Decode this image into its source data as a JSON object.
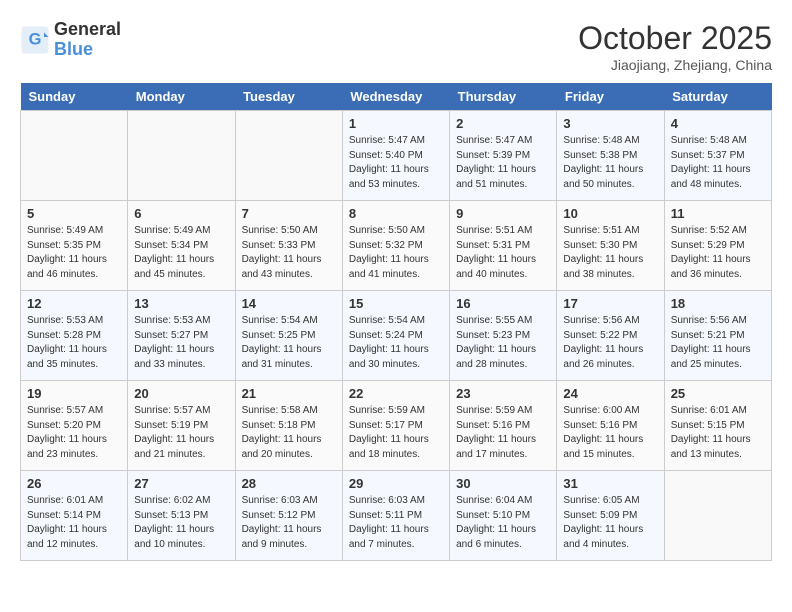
{
  "header": {
    "logo_line1": "General",
    "logo_line2": "Blue",
    "month": "October 2025",
    "location": "Jiaojiang, Zhejiang, China"
  },
  "weekdays": [
    "Sunday",
    "Monday",
    "Tuesday",
    "Wednesday",
    "Thursday",
    "Friday",
    "Saturday"
  ],
  "weeks": [
    [
      {
        "day": "",
        "info": ""
      },
      {
        "day": "",
        "info": ""
      },
      {
        "day": "",
        "info": ""
      },
      {
        "day": "1",
        "info": "Sunrise: 5:47 AM\nSunset: 5:40 PM\nDaylight: 11 hours\nand 53 minutes."
      },
      {
        "day": "2",
        "info": "Sunrise: 5:47 AM\nSunset: 5:39 PM\nDaylight: 11 hours\nand 51 minutes."
      },
      {
        "day": "3",
        "info": "Sunrise: 5:48 AM\nSunset: 5:38 PM\nDaylight: 11 hours\nand 50 minutes."
      },
      {
        "day": "4",
        "info": "Sunrise: 5:48 AM\nSunset: 5:37 PM\nDaylight: 11 hours\nand 48 minutes."
      }
    ],
    [
      {
        "day": "5",
        "info": "Sunrise: 5:49 AM\nSunset: 5:35 PM\nDaylight: 11 hours\nand 46 minutes."
      },
      {
        "day": "6",
        "info": "Sunrise: 5:49 AM\nSunset: 5:34 PM\nDaylight: 11 hours\nand 45 minutes."
      },
      {
        "day": "7",
        "info": "Sunrise: 5:50 AM\nSunset: 5:33 PM\nDaylight: 11 hours\nand 43 minutes."
      },
      {
        "day": "8",
        "info": "Sunrise: 5:50 AM\nSunset: 5:32 PM\nDaylight: 11 hours\nand 41 minutes."
      },
      {
        "day": "9",
        "info": "Sunrise: 5:51 AM\nSunset: 5:31 PM\nDaylight: 11 hours\nand 40 minutes."
      },
      {
        "day": "10",
        "info": "Sunrise: 5:51 AM\nSunset: 5:30 PM\nDaylight: 11 hours\nand 38 minutes."
      },
      {
        "day": "11",
        "info": "Sunrise: 5:52 AM\nSunset: 5:29 PM\nDaylight: 11 hours\nand 36 minutes."
      }
    ],
    [
      {
        "day": "12",
        "info": "Sunrise: 5:53 AM\nSunset: 5:28 PM\nDaylight: 11 hours\nand 35 minutes."
      },
      {
        "day": "13",
        "info": "Sunrise: 5:53 AM\nSunset: 5:27 PM\nDaylight: 11 hours\nand 33 minutes."
      },
      {
        "day": "14",
        "info": "Sunrise: 5:54 AM\nSunset: 5:25 PM\nDaylight: 11 hours\nand 31 minutes."
      },
      {
        "day": "15",
        "info": "Sunrise: 5:54 AM\nSunset: 5:24 PM\nDaylight: 11 hours\nand 30 minutes."
      },
      {
        "day": "16",
        "info": "Sunrise: 5:55 AM\nSunset: 5:23 PM\nDaylight: 11 hours\nand 28 minutes."
      },
      {
        "day": "17",
        "info": "Sunrise: 5:56 AM\nSunset: 5:22 PM\nDaylight: 11 hours\nand 26 minutes."
      },
      {
        "day": "18",
        "info": "Sunrise: 5:56 AM\nSunset: 5:21 PM\nDaylight: 11 hours\nand 25 minutes."
      }
    ],
    [
      {
        "day": "19",
        "info": "Sunrise: 5:57 AM\nSunset: 5:20 PM\nDaylight: 11 hours\nand 23 minutes."
      },
      {
        "day": "20",
        "info": "Sunrise: 5:57 AM\nSunset: 5:19 PM\nDaylight: 11 hours\nand 21 minutes."
      },
      {
        "day": "21",
        "info": "Sunrise: 5:58 AM\nSunset: 5:18 PM\nDaylight: 11 hours\nand 20 minutes."
      },
      {
        "day": "22",
        "info": "Sunrise: 5:59 AM\nSunset: 5:17 PM\nDaylight: 11 hours\nand 18 minutes."
      },
      {
        "day": "23",
        "info": "Sunrise: 5:59 AM\nSunset: 5:16 PM\nDaylight: 11 hours\nand 17 minutes."
      },
      {
        "day": "24",
        "info": "Sunrise: 6:00 AM\nSunset: 5:16 PM\nDaylight: 11 hours\nand 15 minutes."
      },
      {
        "day": "25",
        "info": "Sunrise: 6:01 AM\nSunset: 5:15 PM\nDaylight: 11 hours\nand 13 minutes."
      }
    ],
    [
      {
        "day": "26",
        "info": "Sunrise: 6:01 AM\nSunset: 5:14 PM\nDaylight: 11 hours\nand 12 minutes."
      },
      {
        "day": "27",
        "info": "Sunrise: 6:02 AM\nSunset: 5:13 PM\nDaylight: 11 hours\nand 10 minutes."
      },
      {
        "day": "28",
        "info": "Sunrise: 6:03 AM\nSunset: 5:12 PM\nDaylight: 11 hours\nand 9 minutes."
      },
      {
        "day": "29",
        "info": "Sunrise: 6:03 AM\nSunset: 5:11 PM\nDaylight: 11 hours\nand 7 minutes."
      },
      {
        "day": "30",
        "info": "Sunrise: 6:04 AM\nSunset: 5:10 PM\nDaylight: 11 hours\nand 6 minutes."
      },
      {
        "day": "31",
        "info": "Sunrise: 6:05 AM\nSunset: 5:09 PM\nDaylight: 11 hours\nand 4 minutes."
      },
      {
        "day": "",
        "info": ""
      }
    ]
  ]
}
